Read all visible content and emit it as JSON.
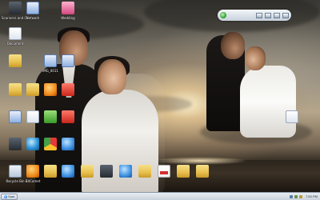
{
  "desktop": {
    "icons": [
      {
        "id": "i1",
        "label": "Scanners and Cameras",
        "type": "app-dark"
      },
      {
        "id": "i2",
        "label": "Network",
        "type": "doc-blue"
      },
      {
        "id": "i3",
        "label": "Wedding",
        "type": "app-pink"
      },
      {
        "id": "i4",
        "label": "Document",
        "type": "doc"
      },
      {
        "id": "i5",
        "label": "",
        "type": "folder"
      },
      {
        "id": "i6",
        "label": "IMG_0011",
        "type": "doc-blue"
      },
      {
        "id": "i7",
        "label": "",
        "type": "doc-blue"
      },
      {
        "id": "i8",
        "label": "",
        "type": "folder"
      },
      {
        "id": "i9",
        "label": "",
        "type": "folder"
      },
      {
        "id": "i10",
        "label": "",
        "type": "app-orange"
      },
      {
        "id": "i11",
        "label": "",
        "type": "app-red"
      },
      {
        "id": "i12",
        "label": "",
        "type": "doc"
      },
      {
        "id": "i13",
        "label": "",
        "type": "doc"
      },
      {
        "id": "i14",
        "label": "",
        "type": "app-green"
      },
      {
        "id": "i15",
        "label": "",
        "type": "app-red"
      },
      {
        "id": "i16",
        "label": "",
        "type": "app-dark"
      },
      {
        "id": "i17",
        "label": "",
        "type": "app-ie"
      },
      {
        "id": "i18",
        "label": "",
        "type": "app-chrome"
      },
      {
        "id": "i19",
        "label": "",
        "type": "app-blue"
      },
      {
        "id": "i20",
        "label": "Recycle Bin",
        "type": "bin"
      },
      {
        "id": "i21",
        "label": "BitComet",
        "type": "app-orange"
      },
      {
        "id": "i22",
        "label": "",
        "type": "folder"
      },
      {
        "id": "i23",
        "label": "",
        "type": "app-blue"
      },
      {
        "id": "i24",
        "label": "",
        "type": "folder"
      },
      {
        "id": "i25",
        "label": "",
        "type": "app-dark"
      },
      {
        "id": "i26",
        "label": "",
        "type": "app-blue"
      },
      {
        "id": "i27",
        "label": "",
        "type": "folder"
      },
      {
        "id": "i28",
        "label": "",
        "type": "app-pdf"
      },
      {
        "id": "i29",
        "label": "",
        "type": "folder"
      },
      {
        "id": "i30",
        "label": "",
        "type": "folder"
      },
      {
        "id": "i31",
        "label": "",
        "type": "doc"
      }
    ]
  },
  "taskbar": {
    "start_label": "Start",
    "clock": "7:52 PM"
  },
  "gadget": {
    "buttons": [
      "logo",
      "slot",
      "slot",
      "slot",
      "slot"
    ]
  }
}
